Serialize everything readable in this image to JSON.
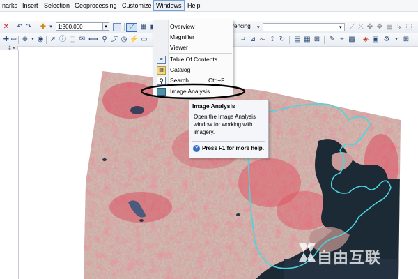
{
  "menubar": {
    "items": [
      {
        "label": "narks"
      },
      {
        "label": "Insert"
      },
      {
        "label": "Selection"
      },
      {
        "label": "Geoprocessing"
      },
      {
        "label": "Customize"
      },
      {
        "label": "Windows"
      },
      {
        "label": "Help"
      }
    ]
  },
  "toolbar": {
    "scale_value": "1:300,000",
    "georef_label": "erencing"
  },
  "panel": {
    "pin_icon": "pin-icon",
    "close_icon": "close-icon",
    "pin_glyph": "‡",
    "close_glyph": "×"
  },
  "windows_menu": {
    "items": [
      {
        "label": "Overview",
        "shortcut": "",
        "icon": ""
      },
      {
        "label": "Magnifier",
        "shortcut": "",
        "icon": ""
      },
      {
        "label": "Viewer",
        "shortcut": "",
        "icon": ""
      },
      {
        "label": "Table Of Contents",
        "shortcut": "",
        "icon": "table-of-contents-icon"
      },
      {
        "label": "Catalog",
        "shortcut": "",
        "icon": "catalog-icon"
      },
      {
        "label": "Search",
        "shortcut": "Ctrl+F",
        "icon": "search-icon"
      },
      {
        "label": "Image Analysis",
        "shortcut": "",
        "icon": "image-analysis-icon"
      }
    ]
  },
  "tooltip": {
    "title": "Image Analysis",
    "body": "Open the Image Analysis window for working with imagery.",
    "help": "Press F1 for more help."
  },
  "watermark": {
    "text": "自由互联"
  },
  "colors": {
    "selection_ring": "#000000",
    "boundary": "#49d6e0",
    "imagery_red": "#d9485a",
    "imagery_base": "#c7a49c",
    "sea": "#1c2a36"
  }
}
